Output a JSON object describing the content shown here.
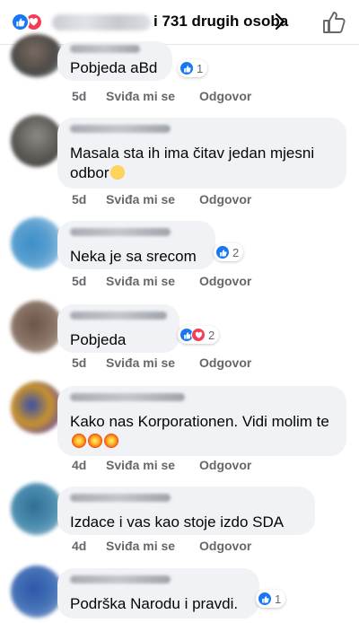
{
  "header": {
    "reactions_text": "i 731 drugih osoba"
  },
  "comments": [
    {
      "text": "Pobjeda aBd",
      "time": "5d",
      "like_label": "Sviđa mi se",
      "reply_label": "Odgovor",
      "reactions": [
        "like"
      ],
      "reaction_count": "1"
    },
    {
      "text": "Masala sta ih ima  čitav jedan mjesni odbor",
      "time": "5d",
      "like_label": "Sviđa mi se",
      "reply_label": "Odgovor",
      "reactions": [],
      "reaction_count": ""
    },
    {
      "text": "Neka je sa srecom",
      "time": "5d",
      "like_label": "Sviđa mi se",
      "reply_label": "Odgovor",
      "reactions": [
        "like"
      ],
      "reaction_count": "2"
    },
    {
      "text": "Pobjeda",
      "time": "5d",
      "like_label": "Sviđa mi se",
      "reply_label": "Odgovor",
      "reactions": [
        "like",
        "love"
      ],
      "reaction_count": "2"
    },
    {
      "text": "Kako nas Korporationen. Vidi molim te",
      "time": "4d",
      "like_label": "Sviđa mi se",
      "reply_label": "Odgovor",
      "reactions": [],
      "reaction_count": ""
    },
    {
      "text": "Izdace i vas kao stoje izdo  SDA",
      "time": "4d",
      "like_label": "Sviđa mi se",
      "reply_label": "Odgovor",
      "reactions": [],
      "reaction_count": ""
    },
    {
      "text": "Podrška Narodu i pravdi.",
      "time": "",
      "like_label": "",
      "reply_label": "",
      "reactions": [
        "like"
      ],
      "reaction_count": "1"
    }
  ],
  "colors": {
    "like": "#1877f2",
    "love": "#f33e58",
    "bubble": "#f0f2f5",
    "meta": "#65676b"
  }
}
